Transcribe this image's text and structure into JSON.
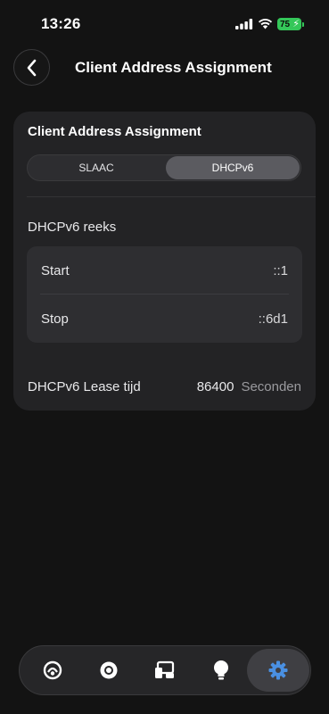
{
  "status_bar": {
    "time": "13:26",
    "battery_percent": "75",
    "battery_color": "#34c759"
  },
  "header": {
    "title": "Client Address Assignment",
    "back_icon": "chevron-left-icon"
  },
  "card": {
    "title": "Client Address Assignment",
    "segments": [
      {
        "label": "SLAAC",
        "selected": false
      },
      {
        "label": "DHCPv6",
        "selected": true
      }
    ],
    "range_label": "DHCPv6 reeks",
    "range_rows": [
      {
        "label": "Start",
        "value": "::1"
      },
      {
        "label": "Stop",
        "value": "::6d1"
      }
    ],
    "lease": {
      "label": "DHCPv6 Lease tijd",
      "value": "86400",
      "unit": "Seconden"
    }
  },
  "tab_bar": {
    "tabs": [
      {
        "icon": "network-icon",
        "selected": false
      },
      {
        "icon": "record-icon",
        "selected": false
      },
      {
        "icon": "devices-icon",
        "selected": false
      },
      {
        "icon": "lightbulb-icon",
        "selected": false
      },
      {
        "icon": "gear-icon",
        "selected": true
      }
    ],
    "accent_color": "#4a90e2"
  }
}
